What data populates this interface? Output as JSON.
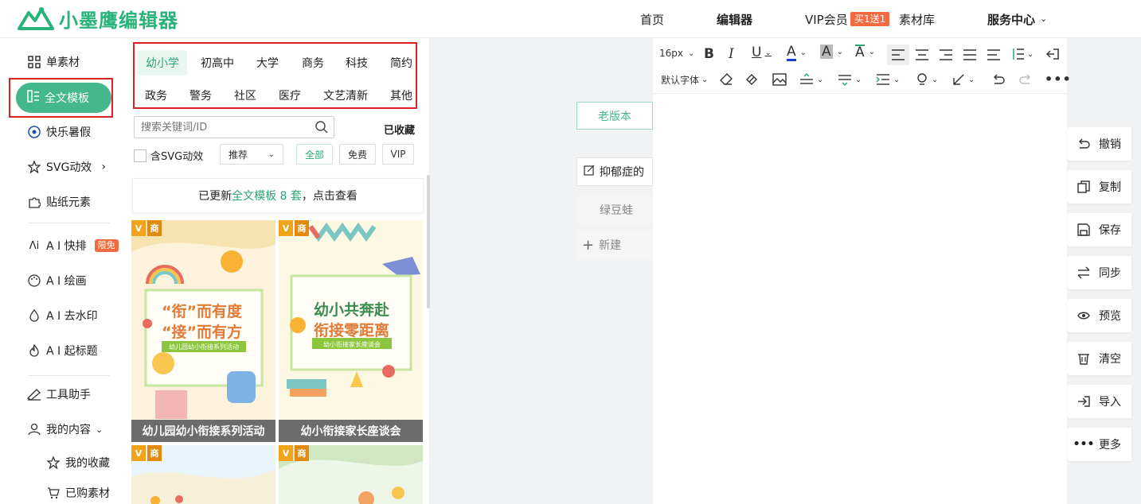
{
  "brand": {
    "name": "小墨鹰编辑器"
  },
  "topnav": {
    "items": [
      "首页",
      "编辑器",
      "VIP会员",
      "素材库",
      "服务中心"
    ],
    "vip_badge": "买1送1"
  },
  "leftnav": {
    "items": [
      {
        "label": "单素材",
        "icon": "grid-icon"
      },
      {
        "label": "全文模板",
        "icon": "template-icon",
        "active": true
      },
      {
        "label": "快乐暑假",
        "icon": "ball-icon"
      },
      {
        "label": "SVG动效",
        "icon": "star-icon"
      },
      {
        "label": "贴纸元素",
        "icon": "puzzle-icon"
      },
      {
        "label": "A I 快排",
        "icon": "ai-icon",
        "badge": "限免"
      },
      {
        "label": "A I 绘画",
        "icon": "palette-icon"
      },
      {
        "label": "A I 去水印",
        "icon": "drop-icon"
      },
      {
        "label": "A I 起标题",
        "icon": "flame-icon"
      },
      {
        "label": "工具助手",
        "icon": "tool-icon"
      },
      {
        "label": "我的内容",
        "icon": "user-icon"
      },
      {
        "label": "我的收藏",
        "icon": "star-outline-icon"
      },
      {
        "label": "已购素材",
        "icon": "cart-icon"
      }
    ]
  },
  "panel": {
    "categories_row1": [
      "幼小学",
      "初高中",
      "大学",
      "商务",
      "科技",
      "简约"
    ],
    "categories_row2": [
      "政务",
      "警务",
      "社区",
      "医疗",
      "文艺清新",
      "其他"
    ],
    "search_placeholder": "搜索关键词/ID",
    "favorites": "已收藏",
    "svg_check": "含SVG动效",
    "sort": "推荐",
    "filters": [
      "全部",
      "免费",
      "VIP"
    ],
    "notice_prefix": "已更新",
    "notice_highlight": "全文模板 8 套",
    "notice_suffix": "，点击查看",
    "cards": [
      {
        "title": "幼儿园幼小衔接系列活动",
        "line1": "“衔”而有度",
        "line2": "“接”而有方",
        "ribbon": "幼儿园幼小衔接系列活动",
        "badge": "商"
      },
      {
        "title": "幼小衔接家长座谈会",
        "line1": "幼小共奔赴",
        "line2": "衔接零距离",
        "ribbon": "幼小衔接家长座谈会",
        "badge": "商"
      },
      {
        "title": "",
        "badge": "商"
      },
      {
        "title": "",
        "badge": "商"
      }
    ]
  },
  "middle": {
    "old_version": "老版本",
    "article": "抑郁症的",
    "draft": "绿豆蛙",
    "new": "新建"
  },
  "editor": {
    "font_size": "16px",
    "font_family": "默认字体"
  },
  "sidebar": {
    "buttons": [
      "撤销",
      "复制",
      "保存",
      "同步",
      "预览",
      "清空",
      "导入",
      "更多"
    ]
  },
  "colors": {
    "accent": "#45b78c",
    "brand": "#2ab27b",
    "badge": "#f26a3f",
    "highlight_box": "#e02020"
  }
}
